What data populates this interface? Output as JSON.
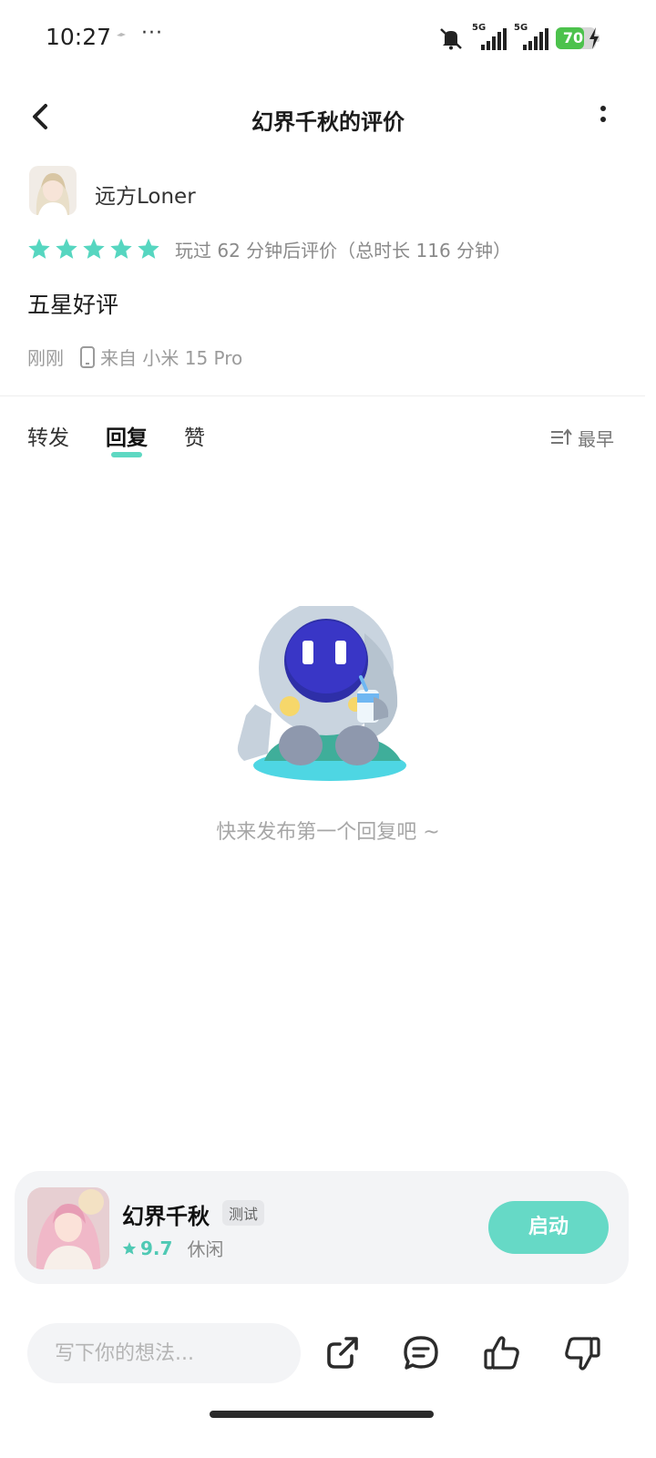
{
  "status_bar": {
    "time": "10:27",
    "dots": "···",
    "network_1": "5G",
    "network_2": "5G",
    "battery_percent": "70",
    "battery_level": 0.7,
    "battery_color": "#4cc24c"
  },
  "header": {
    "title": "幻界千秋的评价",
    "back_icon": "chevron-left-icon",
    "more_icon": "more-vertical-icon"
  },
  "review": {
    "username": "远方Loner",
    "stars": 5,
    "playtime_text": "玩过 62 分钟后评价（总时长 116 分钟）",
    "content": "五星好评",
    "posted_time": "刚刚",
    "device_text": "来自 小米 15 Pro"
  },
  "tabs": [
    {
      "label": "转发",
      "active": false
    },
    {
      "label": "回复",
      "active": true
    },
    {
      "label": "赞",
      "active": false
    }
  ],
  "sort": {
    "label": "最早",
    "icon": "sort-icon"
  },
  "empty_state": {
    "message": "快来发布第一个回复吧 ~",
    "illustration": "robot-mascot"
  },
  "game_card": {
    "name": "幻界千秋",
    "badge": "测试",
    "score": "9.7",
    "genre": "休闲",
    "launch_label": "启动"
  },
  "bottom_bar": {
    "input_placeholder": "写下你的想法...",
    "share_icon": "share-icon",
    "comment_icon": "comment-icon",
    "like_icon": "thumbs-up-icon",
    "dislike_icon": "thumbs-down-icon"
  },
  "colors": {
    "accent": "#5ed8c2",
    "button": "#66d9c6",
    "star": "#56d6c0"
  }
}
